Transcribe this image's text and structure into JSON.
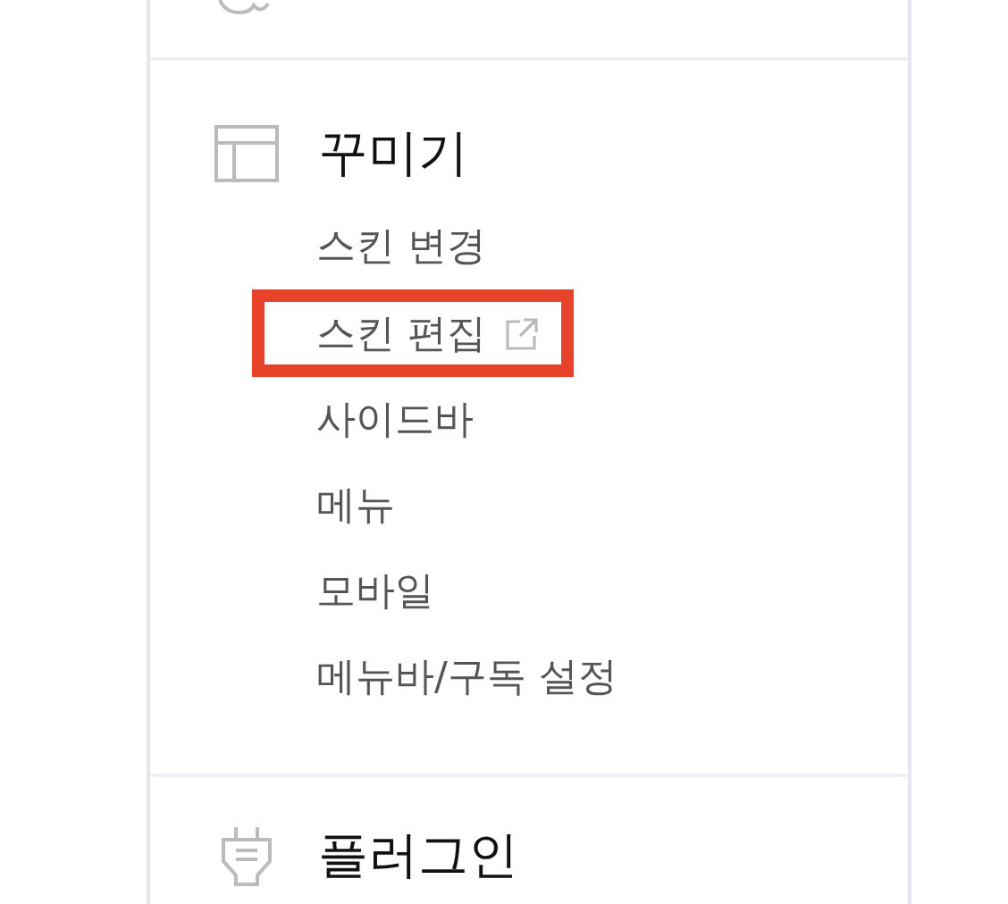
{
  "sections": [
    {
      "title": "꾸미기",
      "items": [
        {
          "label": "스킨 변경",
          "kind": "link",
          "highlighted": false
        },
        {
          "label": "스킨 편집",
          "kind": "external",
          "highlighted": true
        },
        {
          "label": "사이드바",
          "kind": "link",
          "highlighted": false
        },
        {
          "label": "메뉴",
          "kind": "link",
          "highlighted": false
        },
        {
          "label": "모바일",
          "kind": "link",
          "highlighted": false
        },
        {
          "label": "메뉴바/구독 설정",
          "kind": "link",
          "highlighted": false
        }
      ]
    },
    {
      "title": "플러그인"
    }
  ]
}
